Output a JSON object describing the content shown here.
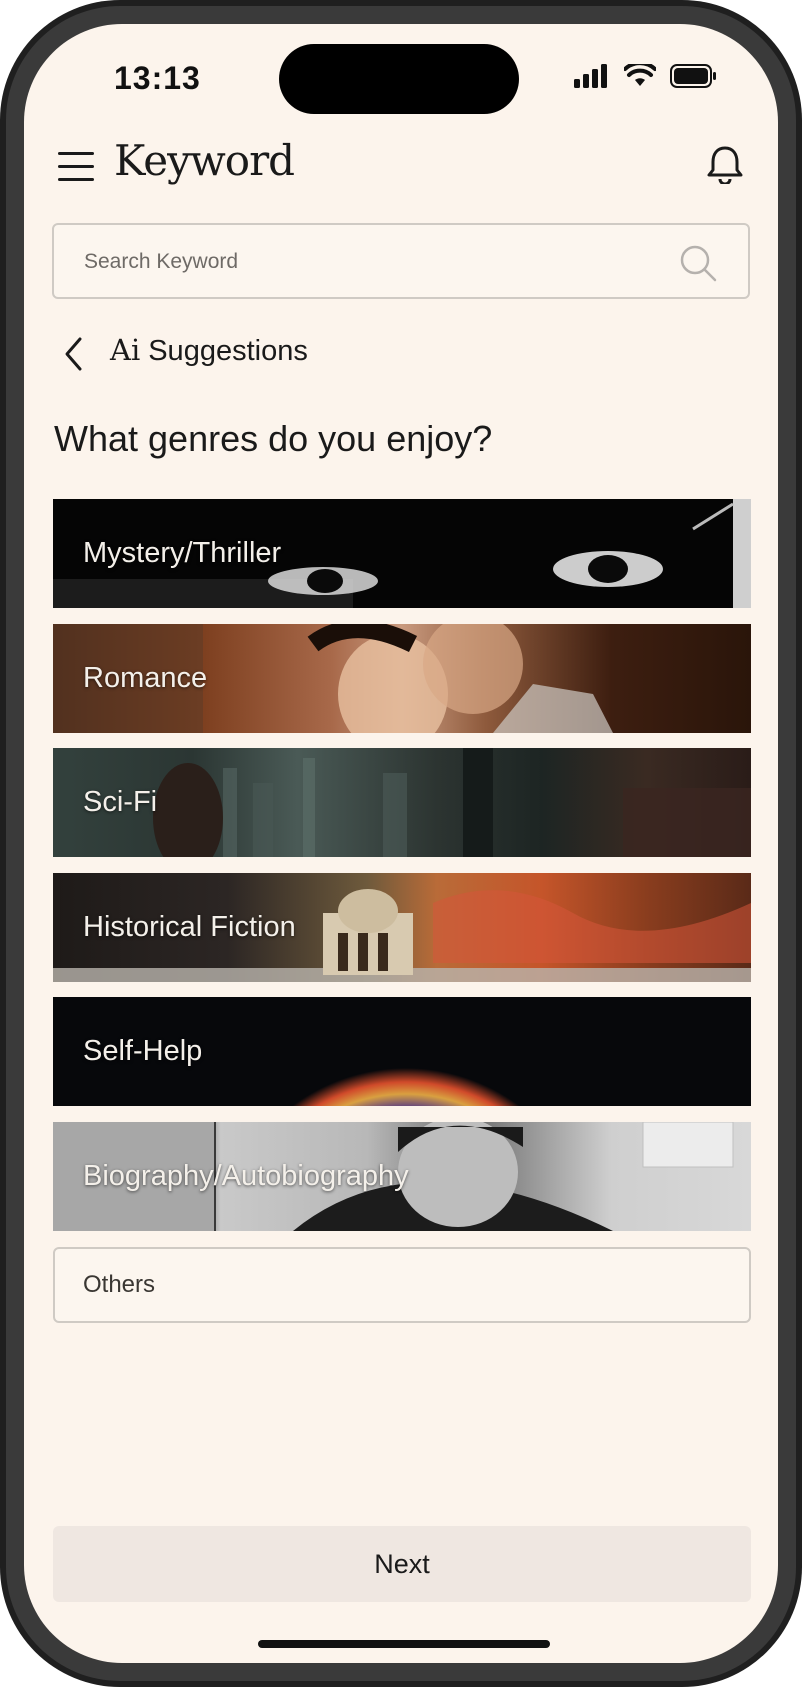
{
  "status_bar": {
    "time": "13:13"
  },
  "header": {
    "app_name": "Keyword"
  },
  "search": {
    "placeholder": "Search Keyword"
  },
  "section": {
    "ai_mark": "Ai",
    "title": "Suggestions"
  },
  "question": "What genres do you enjoy?",
  "genres": [
    {
      "label": "Mystery/Thriller"
    },
    {
      "label": "Romance"
    },
    {
      "label": "Sci-Fi"
    },
    {
      "label": "Historical Fiction"
    },
    {
      "label": "Self-Help"
    },
    {
      "label": "Biography/Autobiography"
    }
  ],
  "others": {
    "label": "Others"
  },
  "next_button": {
    "label": "Next"
  },
  "colors": {
    "background": "#fcf4ec",
    "button": "#efe7e1",
    "border": "#cfcac4",
    "text": "#1a1a1a"
  }
}
